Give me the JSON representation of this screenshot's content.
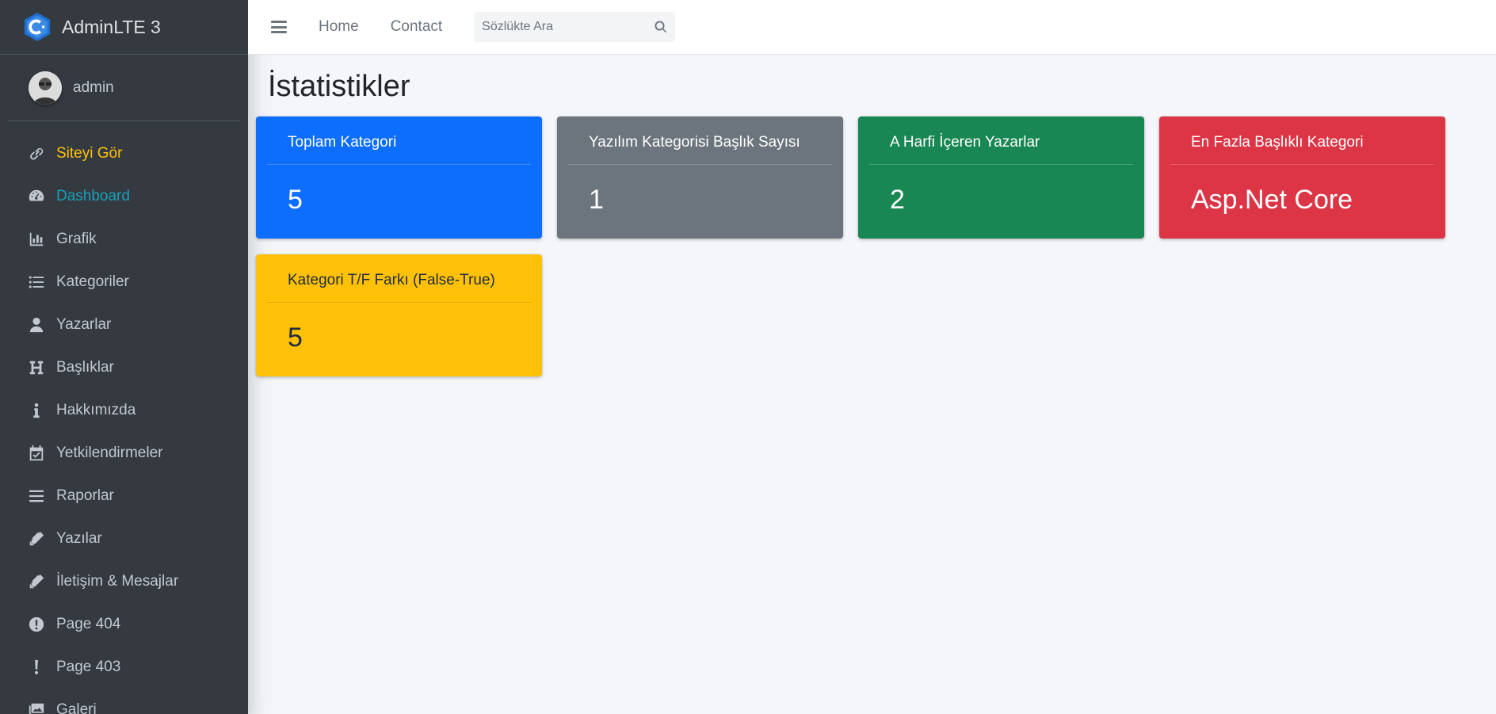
{
  "brand": {
    "name": "AdminLTE 3",
    "logo_icon": "adminlte-logo-icon"
  },
  "user": {
    "name": "admin"
  },
  "sidebar": {
    "items": [
      {
        "label": "Siteyi Gör",
        "icon": "link-icon"
      },
      {
        "label": "Dashboard",
        "icon": "tachometer-icon"
      },
      {
        "label": "Grafik",
        "icon": "chart-bar-icon"
      },
      {
        "label": "Kategoriler",
        "icon": "list-icon"
      },
      {
        "label": "Yazarlar",
        "icon": "user-icon"
      },
      {
        "label": "Başlıklar",
        "icon": "heading-icon"
      },
      {
        "label": "Hakkımızda",
        "icon": "info-icon"
      },
      {
        "label": "Yetkilendirmeler",
        "icon": "calendar-check-icon"
      },
      {
        "label": "Raporlar",
        "icon": "bars-icon"
      },
      {
        "label": "Yazılar",
        "icon": "pen-icon"
      },
      {
        "label": "İletişim & Mesajlar",
        "icon": "pen-icon"
      },
      {
        "label": "Page 404",
        "icon": "exclamation-circle-icon"
      },
      {
        "label": "Page 403",
        "icon": "exclamation-icon"
      },
      {
        "label": "Galeri",
        "icon": "images-icon"
      }
    ]
  },
  "topbar": {
    "links": [
      "Home",
      "Contact"
    ],
    "search_placeholder": "Sözlükte Ara"
  },
  "page": {
    "title": "İstatistikler"
  },
  "cards": [
    {
      "title": "Toplam Kategori",
      "value": "5",
      "color": "#0d6efd"
    },
    {
      "title": "Yazılım Kategorisi Başlık Sayısı",
      "value": "1",
      "color": "#6c757d"
    },
    {
      "title": "A Harfi İçeren Yazarlar",
      "value": "2",
      "color": "#198754"
    },
    {
      "title": "En Fazla Başlıklı Kategori",
      "value": "Asp.Net Core",
      "color": "#dc3545"
    },
    {
      "title": "Kategori T/F Farkı (False-True)",
      "value": "5",
      "color": "#ffc107"
    }
  ],
  "colors": {
    "sidebar_bg": "#343a40",
    "active_site": "#ffc107",
    "active_dashboard": "#17a2b8"
  }
}
